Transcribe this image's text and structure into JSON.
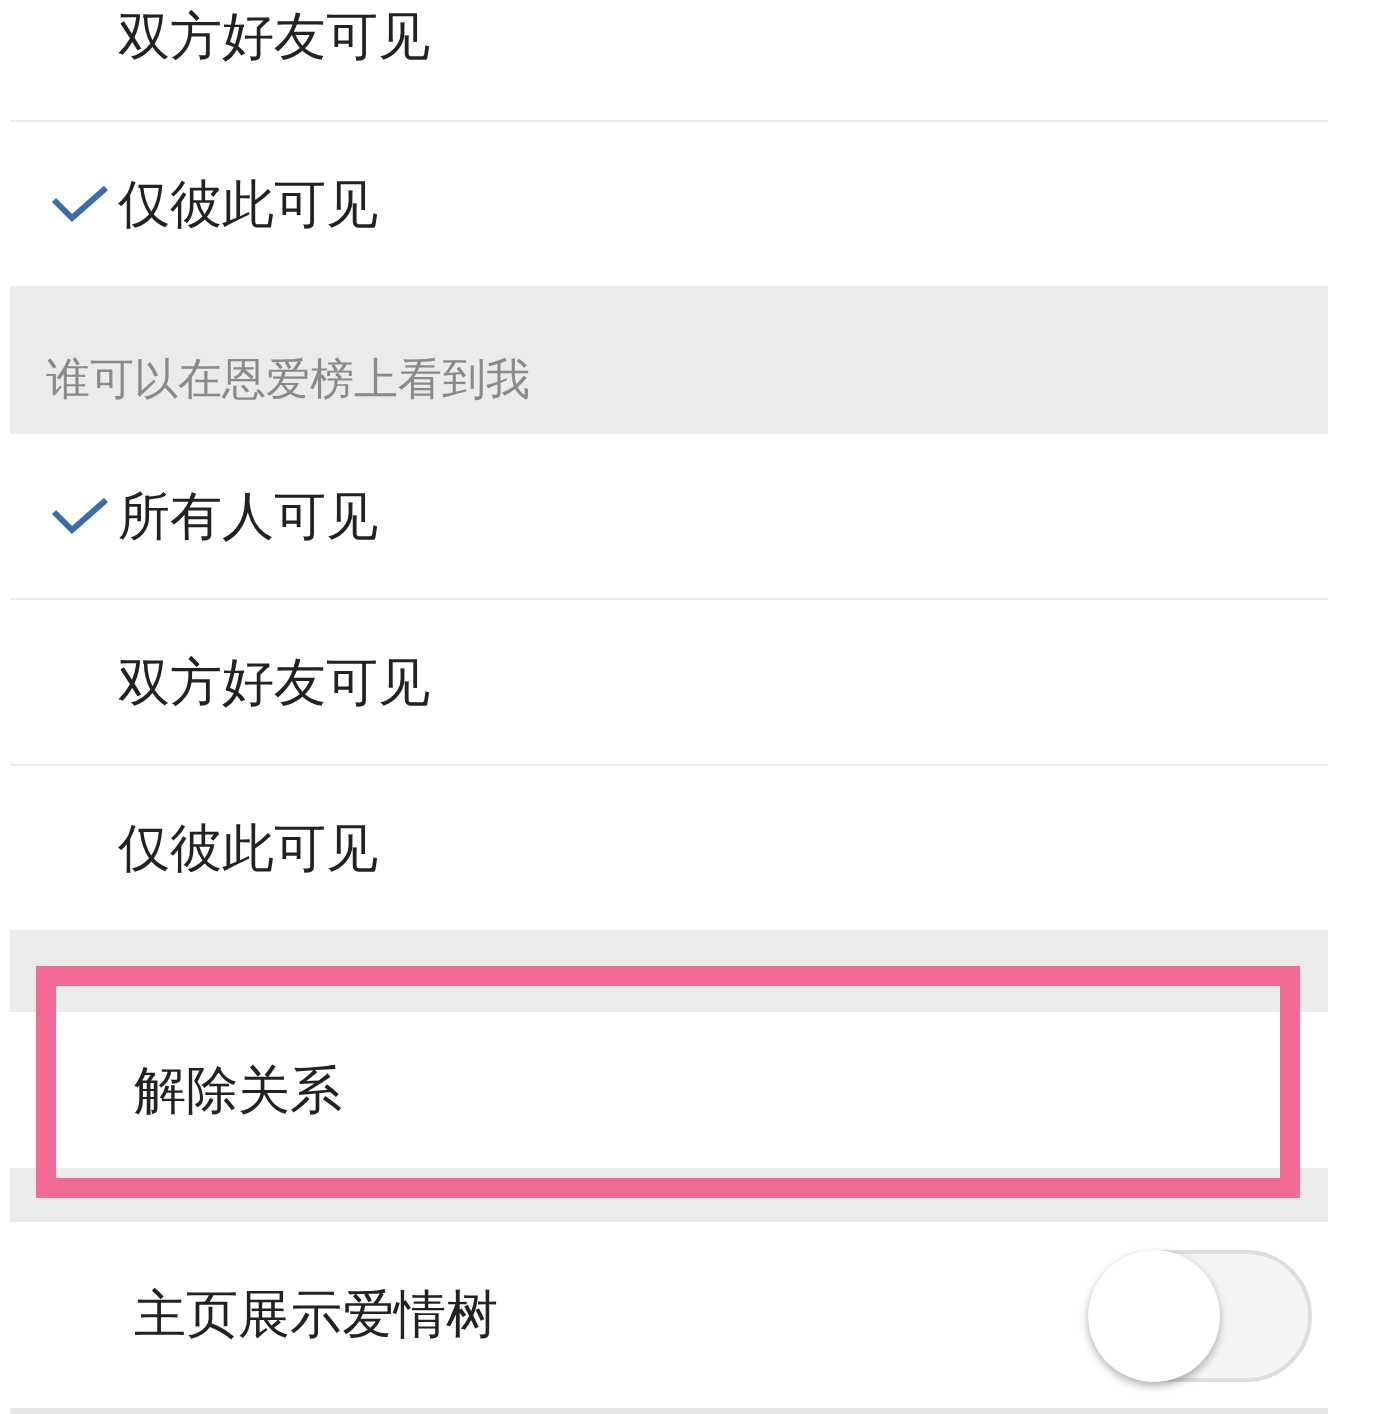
{
  "rows": [
    {
      "kind": "option",
      "label": "双方好友可见",
      "selected": false
    },
    {
      "kind": "option",
      "label": "仅彼此可见",
      "selected": true
    },
    {
      "kind": "header",
      "label": "谁可以在恩爱榜上看到我"
    },
    {
      "kind": "option",
      "label": "所有人可见",
      "selected": true
    },
    {
      "kind": "option",
      "label": "双方好友可见",
      "selected": false
    },
    {
      "kind": "option",
      "label": "仅彼此可见",
      "selected": false
    },
    {
      "kind": "action",
      "label": "解除关系",
      "highlighted": true
    },
    {
      "kind": "switch",
      "label": "主页展示爱情树",
      "on": false
    }
  ]
}
